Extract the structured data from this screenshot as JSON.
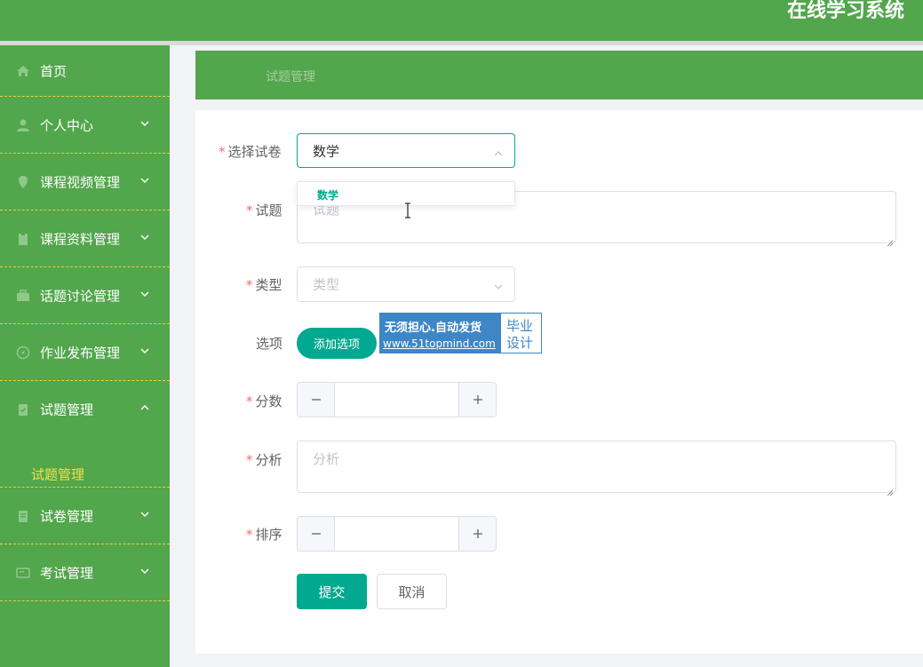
{
  "app": {
    "title": "在线学习系统"
  },
  "sidebar": {
    "items": [
      {
        "label": "首页",
        "icon": "home-icon"
      },
      {
        "label": "个人中心",
        "icon": "user-icon"
      },
      {
        "label": "课程视频管理",
        "icon": "location-icon"
      },
      {
        "label": "课程资料管理",
        "icon": "clipboard-icon"
      },
      {
        "label": "话题讨论管理",
        "icon": "briefcase-icon"
      },
      {
        "label": "作业发布管理",
        "icon": "compass-icon"
      },
      {
        "label": "试题管理",
        "icon": "checklist-icon",
        "expanded": true
      },
      {
        "label": "试卷管理",
        "icon": "document-icon"
      },
      {
        "label": "考试管理",
        "icon": "monitor-icon"
      }
    ],
    "submenu": {
      "label": "试题管理"
    }
  },
  "breadcrumb": {
    "current": "试题管理"
  },
  "form": {
    "required_mark": "*",
    "paper": {
      "label": "选择试卷",
      "value": "数学",
      "option": "数学"
    },
    "question": {
      "label": "试题",
      "placeholder": "试题"
    },
    "type": {
      "label": "类型",
      "placeholder": "类型"
    },
    "options": {
      "label": "选项",
      "add_button": "添加选项"
    },
    "score": {
      "label": "分数",
      "value": ""
    },
    "analysis": {
      "label": "分析",
      "placeholder": "分析"
    },
    "order": {
      "label": "排序",
      "value": ""
    },
    "submit": "提交",
    "cancel": "取消"
  },
  "watermark": {
    "line1": "无须担心.自动发货",
    "line2": "www.51topmind.com",
    "right1": "毕业",
    "right2": "设计"
  },
  "colors": {
    "header_green": "#52a64c",
    "accent_teal": "#00a98f",
    "submenu_yellow": "#f2e14b",
    "required_red": "#f56c6c"
  }
}
